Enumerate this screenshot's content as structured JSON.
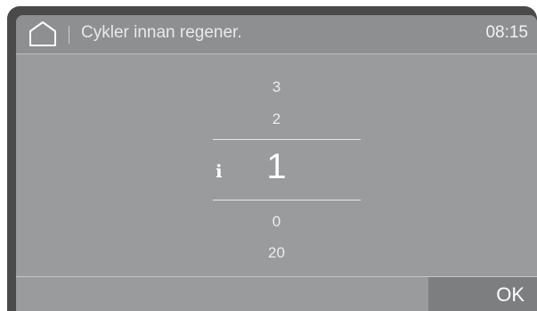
{
  "header": {
    "title": "Cykler innan regener.",
    "clock": "08:15",
    "home_icon": "home-icon"
  },
  "picker": {
    "values_above": [
      "3",
      "2"
    ],
    "selected": "1",
    "values_below": [
      "0",
      "20"
    ],
    "info_icon": "info-icon",
    "info_symbol": "i"
  },
  "footer": {
    "ok_label": "OK"
  },
  "colors": {
    "frame": "#4a4a4a",
    "screen": "#9a9b9d",
    "header": "#8e8f91",
    "ok_button": "#7d7e80",
    "text": "#ffffff"
  }
}
